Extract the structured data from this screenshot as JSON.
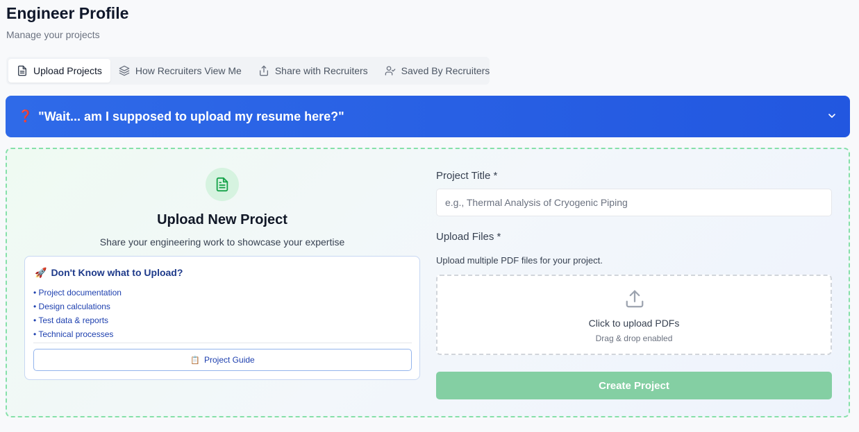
{
  "header": {
    "title": "Engineer Profile",
    "subtitle": "Manage your projects"
  },
  "tabs": [
    {
      "label": "Upload Projects",
      "icon": "document-icon",
      "active": true
    },
    {
      "label": "How Recruiters View Me",
      "icon": "layers-icon",
      "active": false
    },
    {
      "label": "Share with Recruiters",
      "icon": "share-icon",
      "active": false
    },
    {
      "label": "Saved By Recruiters",
      "icon": "user-check-icon",
      "active": false
    }
  ],
  "banner": {
    "emoji": "❓",
    "text": "\"Wait... am I supposed to upload my resume here?\"",
    "icon": "chevron-down-icon"
  },
  "upload": {
    "icon": "document-icon",
    "title": "Upload New Project",
    "subtitle": "Share your engineering work to showcase your expertise"
  },
  "tips": {
    "emoji": "🚀",
    "title": "Don't Know what to Upload?",
    "items": [
      "Project documentation",
      "Design calculations",
      "Test data & reports",
      "Technical processes"
    ],
    "guide_emoji": "📋",
    "guide_label": "Project Guide"
  },
  "form": {
    "title_label": "Project Title *",
    "title_placeholder": "e.g., Thermal Analysis of Cryogenic Piping",
    "files_label": "Upload Files *",
    "files_hint": "Upload multiple PDF files for your project.",
    "dropzone_main": "Click to upload PDFs",
    "dropzone_sub": "Drag & drop enabled",
    "submit_label": "Create Project"
  },
  "colors": {
    "banner": "#2257e0",
    "accent_green": "#84cfa3",
    "dashed_border": "#86e0a9",
    "link_blue": "#1e40af"
  }
}
